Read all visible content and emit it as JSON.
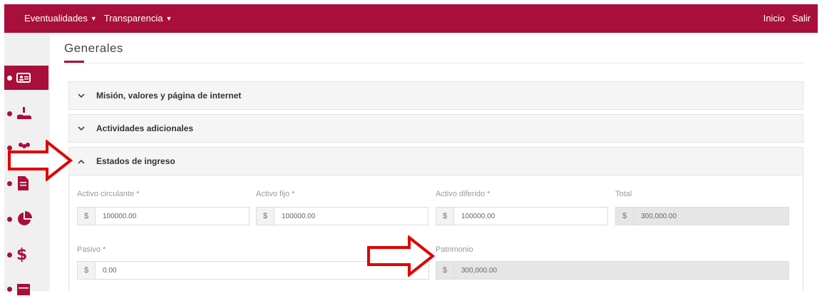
{
  "topbar": {
    "menu_eventualidades": "Eventualidades",
    "menu_transparencia": "Transparencia",
    "link_inicio": "Inicio",
    "link_salir": "Salir",
    "brand_color": "#a80f3a"
  },
  "page": {
    "title": "Generales"
  },
  "accordion": {
    "mision": "Misión, valores y página de internet",
    "actividades": "Actividades adicionales",
    "estados": "Estados de ingreso"
  },
  "form": {
    "currency_symbol": "$",
    "activo_circulante_label": "Activo circulante *",
    "activo_circulante_value": "100000.00",
    "activo_fijo_label": "Activo fijo *",
    "activo_fijo_value": "100000.00",
    "activo_diferido_label": "Activo diferido *",
    "activo_diferido_value": "100000.00",
    "total_label": "Total",
    "total_value": "300,000.00",
    "pasivo_label": "Pasivo *",
    "pasivo_value": "0.00",
    "patrimonio_label": "Patrimonio",
    "patrimonio_value": "300,000.00"
  },
  "sidebar_icons": [
    "id-card-icon",
    "hand-donate-icon",
    "people-icon",
    "document-icon",
    "pie-chart-icon",
    "dollar-icon",
    "calendar-icon"
  ]
}
